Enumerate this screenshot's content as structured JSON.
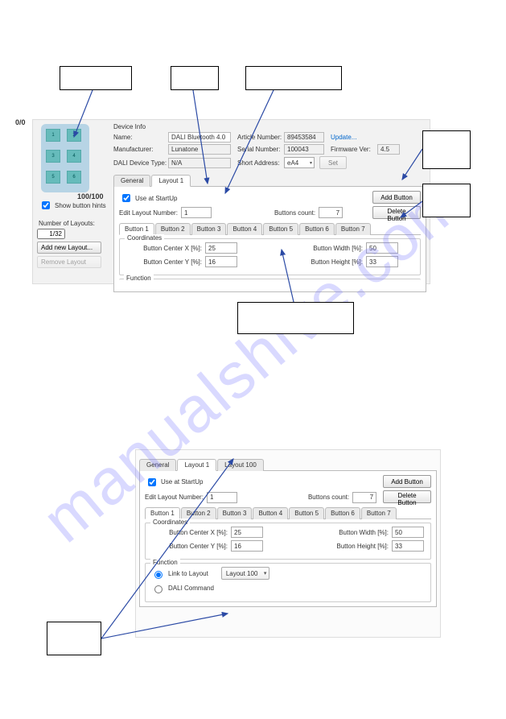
{
  "watermark": "manualshive.com",
  "fig1": {
    "coords": {
      "tl": "0/0",
      "br": "100/100"
    },
    "preview_buttons": [
      "1",
      "2",
      "3",
      "4",
      "5",
      "6"
    ],
    "show_hints_label": "Show button hints",
    "num_layouts_label": "Number of Layouts:",
    "num_layouts_value": "1/32",
    "add_layout": "Add new Layout...",
    "remove_layout": "Remove Layout",
    "device_info": {
      "title": "Device Info",
      "name_label": "Name:",
      "name_value": "DALI Bluetooth 4.0",
      "manufacturer_label": "Manufacturer:",
      "manufacturer_value": "Lunatone",
      "devtype_label": "DALI Device Type:",
      "devtype_value": "N/A",
      "article_label": "Article Number:",
      "article_value": "89453584",
      "serial_label": "Serial Number:",
      "serial_value": "100043",
      "shortaddr_label": "Short Address:",
      "shortaddr_value": "eA4",
      "update": "Update...",
      "fw_label": "Firmware Ver:",
      "fw_value": "4.5",
      "set": "Set"
    },
    "tabs": {
      "general": "General",
      "layout1": "Layout 1"
    },
    "use_at_startup": "Use at StartUp",
    "edit_layout_label": "Edit Layout Number:",
    "edit_layout_value": "1",
    "buttons_count_label": "Buttons count:",
    "buttons_count_value": "7",
    "add_button": "Add Button",
    "delete_button": "Delete Button",
    "button_tabs": [
      "Button 1",
      "Button 2",
      "Button 3",
      "Button 4",
      "Button 5",
      "Button 6",
      "Button 7"
    ],
    "coordinates_title": "Coordinates",
    "bcx_label": "Button Center X [%]:",
    "bcx_value": "25",
    "bcy_label": "Button Center Y [%]:",
    "bcy_value": "16",
    "bw_label": "Button Width [%]:",
    "bw_value": "50",
    "bh_label": "Button Height [%]:",
    "bh_value": "33",
    "function_title": "Function"
  },
  "fig2": {
    "tabs": {
      "general": "General",
      "layout1": "Layout 1",
      "layout100": "Layout 100"
    },
    "use_at_startup": "Use at StartUp",
    "edit_layout_label": "Edit Layout Number:",
    "edit_layout_value": "1",
    "buttons_count_label": "Buttons count:",
    "buttons_count_value": "7",
    "add_button": "Add Button",
    "delete_button": "Delete Button",
    "button_tabs": [
      "Button 1",
      "Button 2",
      "Button 3",
      "Button 4",
      "Button 5",
      "Button 6",
      "Button 7"
    ],
    "coordinates_title": "Coordinates",
    "bcx_label": "Button Center X [%]:",
    "bcx_value": "25",
    "bcy_label": "Button Center Y [%]:",
    "bcy_value": "16",
    "bw_label": "Button Width [%]:",
    "bw_value": "50",
    "bh_label": "Button Height [%]:",
    "bh_value": "33",
    "function_title": "Function",
    "link_to_layout": "Link to Layout",
    "link_value": "Layout 100",
    "dali_command": "DALI Command"
  }
}
